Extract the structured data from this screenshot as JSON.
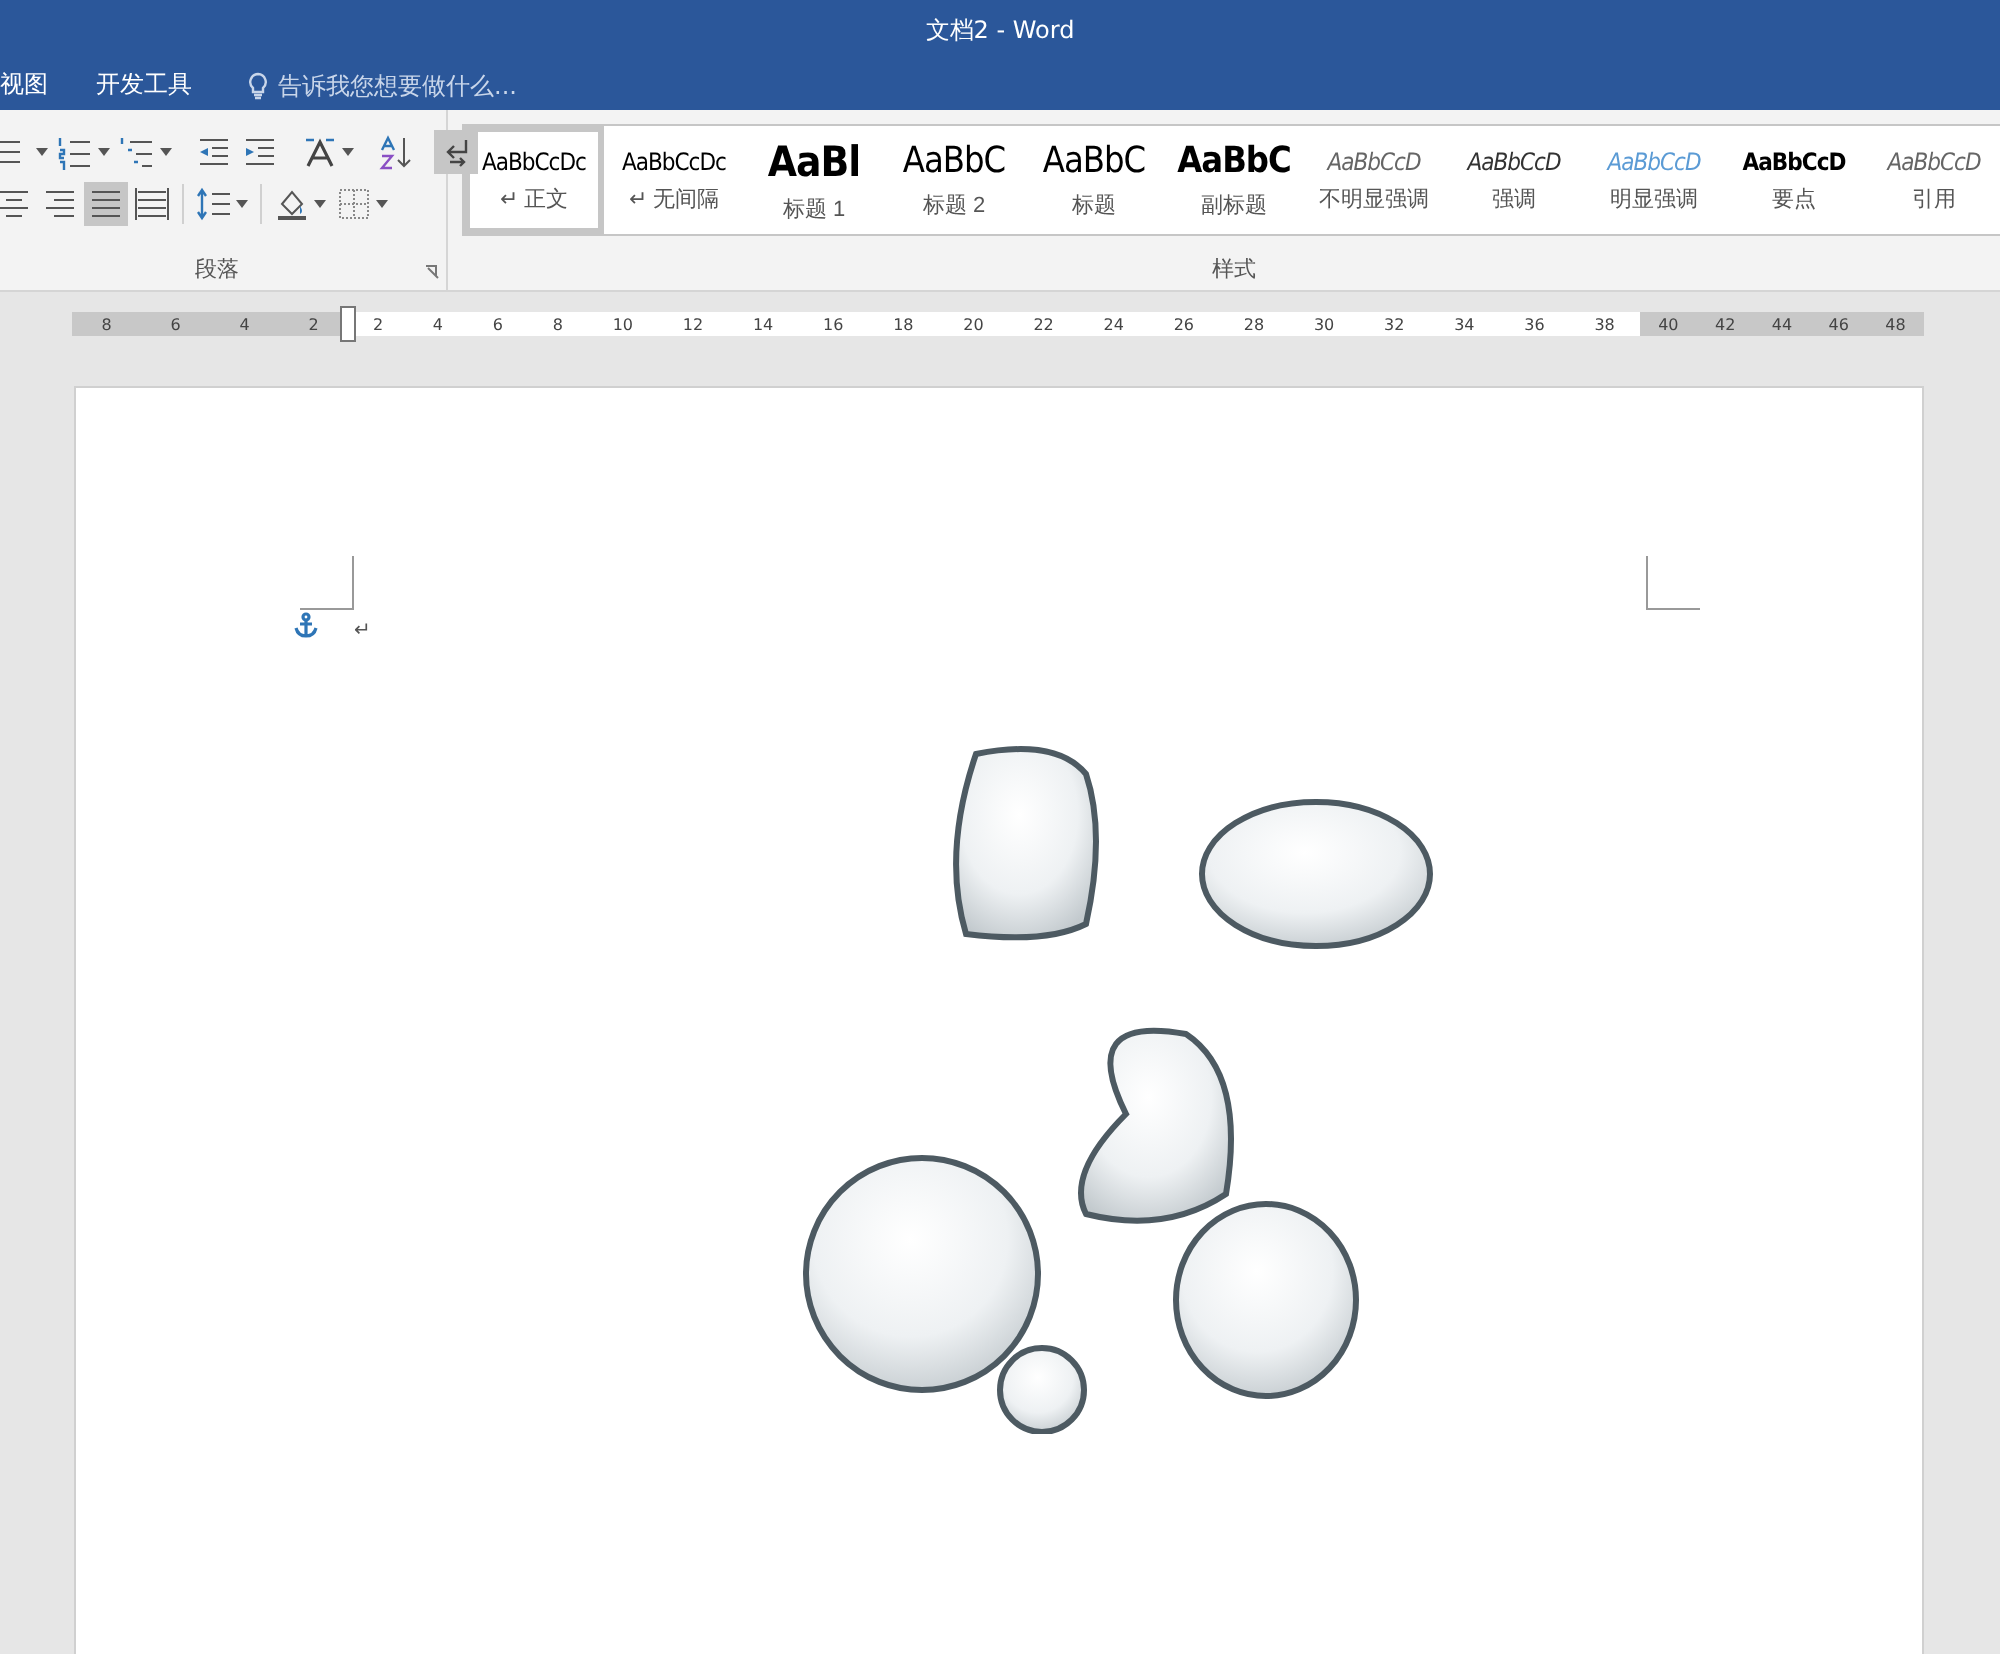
{
  "window": {
    "title": "文档2 - Word"
  },
  "ribbon_tabs": [
    {
      "label": "视图",
      "selected": false
    },
    {
      "label": "开发工具",
      "selected": false
    }
  ],
  "tell_me": {
    "placeholder": "告诉我您想要做什么..."
  },
  "paragraph_group": {
    "label": "段落",
    "tool_rows": [
      [
        {
          "kind": "bullets",
          "selected": false,
          "dropdown": true
        },
        {
          "kind": "numbering",
          "selected": false,
          "dropdown": true
        },
        {
          "kind": "multilevel",
          "selected": false,
          "dropdown": true
        },
        {
          "kind": "outdent",
          "selected": false,
          "dropdown": false
        },
        {
          "kind": "indent",
          "selected": false,
          "dropdown": false
        },
        {
          "kind": "textdir",
          "selected": false,
          "dropdown": true
        },
        {
          "kind": "sort",
          "selected": false,
          "dropdown": false
        },
        {
          "kind": "marks",
          "selected": true,
          "dropdown": false
        }
      ],
      [
        {
          "kind": "center",
          "selected": false,
          "dropdown": false
        },
        {
          "kind": "right",
          "selected": false,
          "dropdown": false
        },
        {
          "kind": "justify",
          "selected": true,
          "dropdown": false
        },
        {
          "kind": "distribute",
          "selected": false,
          "dropdown": false
        },
        {
          "kind": "spacing",
          "selected": false,
          "dropdown": true
        },
        {
          "kind": "shading",
          "selected": false,
          "dropdown": true
        },
        {
          "kind": "borders",
          "selected": false,
          "dropdown": true
        }
      ]
    ]
  },
  "styles_group": {
    "label": "样式",
    "styles": [
      {
        "preview": "AaBbCcDc",
        "label": "↵ 正文",
        "kind": "normal",
        "selected": true
      },
      {
        "preview": "AaBbCcDc",
        "label": "↵ 无间隔",
        "kind": "normal",
        "selected": false
      },
      {
        "preview": "AaBl",
        "label": "标题 1",
        "kind": "h1",
        "selected": false
      },
      {
        "preview": "AaBbC",
        "label": "标题 2",
        "kind": "h2",
        "selected": false
      },
      {
        "preview": "AaBbC",
        "label": "标题",
        "kind": "h2",
        "selected": false
      },
      {
        "preview": "AaBbC",
        "label": "副标题",
        "kind": "subtitle",
        "selected": false
      },
      {
        "preview": "AaBbCcD",
        "label": "不明显强调",
        "kind": "italic-gray",
        "selected": false
      },
      {
        "preview": "AaBbCcD",
        "label": "强调",
        "kind": "italic",
        "selected": false
      },
      {
        "preview": "AaBbCcD",
        "label": "明显强调",
        "kind": "italic-blue",
        "selected": false
      },
      {
        "preview": "AaBbCcD",
        "label": "要点",
        "kind": "strong",
        "selected": false
      },
      {
        "preview": "AaBbCcD",
        "label": "引用",
        "kind": "italic-gray",
        "selected": false
      }
    ]
  },
  "ruler": {
    "left_labels": [
      "8",
      "6",
      "4",
      "2"
    ],
    "labels": [
      "2",
      "4",
      "6",
      "8",
      "10",
      "12",
      "14",
      "16",
      "18",
      "20",
      "22",
      "24",
      "26",
      "28",
      "30",
      "32",
      "34",
      "36",
      "38"
    ],
    "right_labels": [
      "40",
      "42",
      "44",
      "46",
      "48"
    ]
  },
  "document": {
    "paragraph_mark": "↵"
  }
}
